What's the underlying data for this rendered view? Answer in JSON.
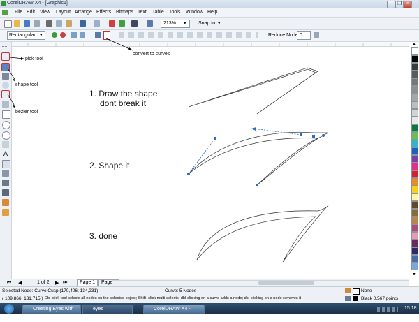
{
  "window": {
    "title": "CorelDRAW X4 - [Graphic1]",
    "minimize": "_",
    "restore": "❐",
    "close": "×"
  },
  "menu": [
    "File",
    "Edit",
    "View",
    "Layout",
    "Arrange",
    "Effects",
    "Bitmaps",
    "Text",
    "Table",
    "Tools",
    "Window",
    "Help"
  ],
  "toolbar": {
    "zoom": "213%",
    "snap_to": "Snap to"
  },
  "propbar": {
    "marquee_type": "Rectangular",
    "reduce_nodes_label": "Reduce Nodes",
    "reduce_nodes_value": "0"
  },
  "annotations": {
    "convert_to_curves": "convert to curves",
    "pick_tool": "pick tool",
    "shape_tool": "shape tool",
    "bezier_tool": "bezier tool"
  },
  "steps": {
    "step1_line1": "1. Draw the shape",
    "step1_line2": "dont break it",
    "step2": "2. Shape it",
    "step3": "3. done"
  },
  "pages": {
    "indicator": "1 of 2",
    "tab1": "Page 1",
    "tab2": "Page 2"
  },
  "status": {
    "selected": "Selected Node: Curve Cusp (170,406; 134,231)",
    "curve": "Curve: 5 Nodes",
    "coords": "( 109,866; 131,715 )",
    "hint": "Dbl-click tool selects all nodes on the selected object; Shift+click multi-selects; dbl-clicking on a curve adds a node; dbl-clicking on a node removes it",
    "fill": "None",
    "outline": "Black  0,567 points"
  },
  "taskbar": {
    "start": "",
    "items": [
      "Creating Eyes with C...",
      "eyes",
      "CorelDRAW X4 - [Gra..."
    ],
    "clock": "15:18"
  },
  "palette": [
    "#ffffff",
    "#000000",
    "#3a3a3a",
    "#5a5a5a",
    "#777777",
    "#8e8e8e",
    "#a6a6a6",
    "#bdbdbd",
    "#d2d2d2",
    "#e8e8e8",
    "#0a7a3a",
    "#6cc04a",
    "#2fb7c9",
    "#1f5fbf",
    "#7a3fa8",
    "#e0308a",
    "#d8202a",
    "#f08a1a",
    "#f5d21a",
    "#fff3a8",
    "#5c4a2a",
    "#8a6a3a",
    "#b8864a",
    "#b04a7a",
    "#e89ab0",
    "#6a2a5a",
    "#2a2a6a",
    "#4a6aa8",
    "#7aa8d8"
  ]
}
